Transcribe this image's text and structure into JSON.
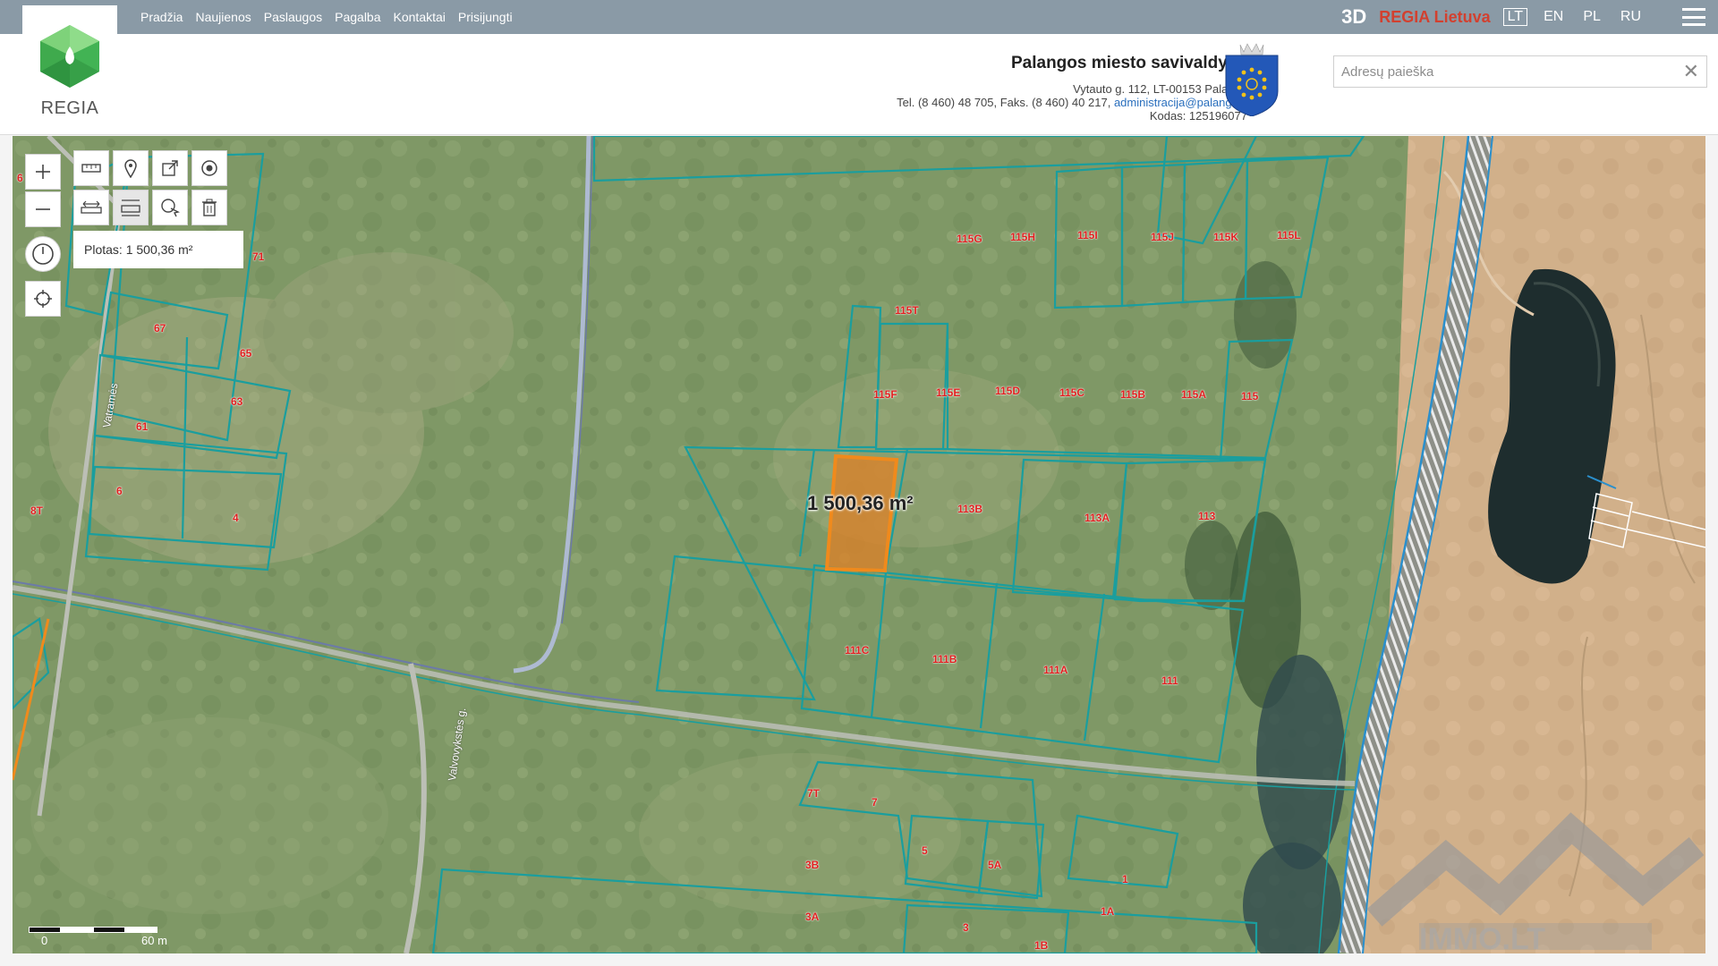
{
  "nav": {
    "items": [
      "Pradžia",
      "Naujienos",
      "Paslaugos",
      "Pagalba",
      "Kontaktai",
      "Prisijungti"
    ],
    "btn_3d": "3D",
    "regia_lietuva": "REGIA Lietuva",
    "languages": [
      "LT",
      "EN",
      "PL",
      "RU"
    ],
    "active_language": "LT"
  },
  "logo": {
    "text": "REGIA"
  },
  "municipality": {
    "name": "Palangos miesto savivaldybė",
    "address": "Vytauto g. 112, LT-00153 Palanga",
    "phone": "Tel. (8 460) 48 705, Faks. (8 460) 40 217,",
    "email": "administracija@palanga.lt",
    "code": "Kodas: 125196077"
  },
  "search": {
    "placeholder": "Adresų paieška",
    "value": ""
  },
  "map": {
    "area_tooltip": "Plotas: 1 500,36 m²",
    "area_label": "1 500,36 m²",
    "scale": {
      "start": "0",
      "end": "60 m"
    },
    "street_labels": [
      "Vatramės",
      "Valvovykstės g."
    ],
    "parcel_labels": [
      "115G",
      "115H",
      "115I",
      "115J",
      "115K",
      "115L",
      "115T",
      "115F",
      "115E",
      "115D",
      "115C",
      "115B",
      "115A",
      "115",
      "113B",
      "113A",
      "113",
      "111C",
      "111B",
      "111A",
      "111",
      "71",
      "67",
      "65",
      "63",
      "61",
      "6",
      "4",
      "8T",
      "6",
      "7T",
      "7",
      "5",
      "5A",
      "3B",
      "3A",
      "3",
      "1",
      "1A",
      "1B"
    ],
    "colors": {
      "parcel_line": "#1a9e9e",
      "parcel_label": "#e02020",
      "selection": "#f08a1c",
      "railway": "#2a8fcc"
    }
  },
  "watermark": {
    "text": "IMMO.LT"
  }
}
